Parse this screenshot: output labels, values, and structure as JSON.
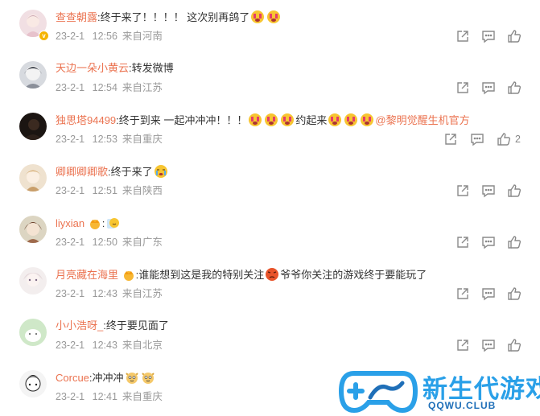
{
  "comments": [
    {
      "user": "查查朝露",
      "sep": ":",
      "text": "终于来了！！！！ 这次别再鸽了",
      "date": "23-2-1",
      "time": "12:56",
      "location": "来自河南",
      "verified": true,
      "emojis_after": 2,
      "like_count": ""
    },
    {
      "user": "天边一朵小黄云",
      "sep": ":",
      "text": "转发微博",
      "date": "23-2-1",
      "time": "12:54",
      "location": "来自江苏",
      "like_count": ""
    },
    {
      "user": "独思塔94499",
      "sep": ":",
      "text": "终于到来 一起冲冲冲！！！",
      "text2": "约起来",
      "mention": "@黎明觉醒生机官方",
      "date": "23-2-1",
      "time": "12:53",
      "location": "来自重庆",
      "like_count": "2"
    },
    {
      "user": "卿卿卿卿歌",
      "sep": ":",
      "text": "终于来了",
      "date": "23-2-1",
      "time": "12:51",
      "location": "来自陕西",
      "like_count": ""
    },
    {
      "user": "liyxian",
      "sep": ":",
      "text": "",
      "date": "23-2-1",
      "time": "12:50",
      "location": "来自广东",
      "like_count": ""
    },
    {
      "user": "月亮藏在海里",
      "sep": ":",
      "text": "谁能想到这是我的特别关注",
      "text2": "爷爷你关注的游戏终于要能玩了",
      "date": "23-2-1",
      "time": "12:43",
      "location": "来自江苏",
      "like_count": ""
    },
    {
      "user": "小小浩呀_",
      "sep": ":",
      "text": "终于要见面了",
      "date": "23-2-1",
      "time": "12:43",
      "location": "来自北京",
      "like_count": ""
    },
    {
      "user": "Corcue",
      "sep": ":",
      "text": "冲冲冲",
      "date": "23-2-1",
      "time": "12:41",
      "location": "来自重庆",
      "like_count": ""
    }
  ],
  "watermark": {
    "title": "新生代游戏",
    "subtitle": "QQWU.CLUB"
  },
  "colors": {
    "username": "#eb7350",
    "text": "#333333",
    "meta": "#999999",
    "icon": "#8a8a8a",
    "watermark": "#2aa0e8"
  },
  "icons": {
    "share": "share-icon",
    "comment": "comment-icon",
    "like": "thumbs-up-icon"
  }
}
